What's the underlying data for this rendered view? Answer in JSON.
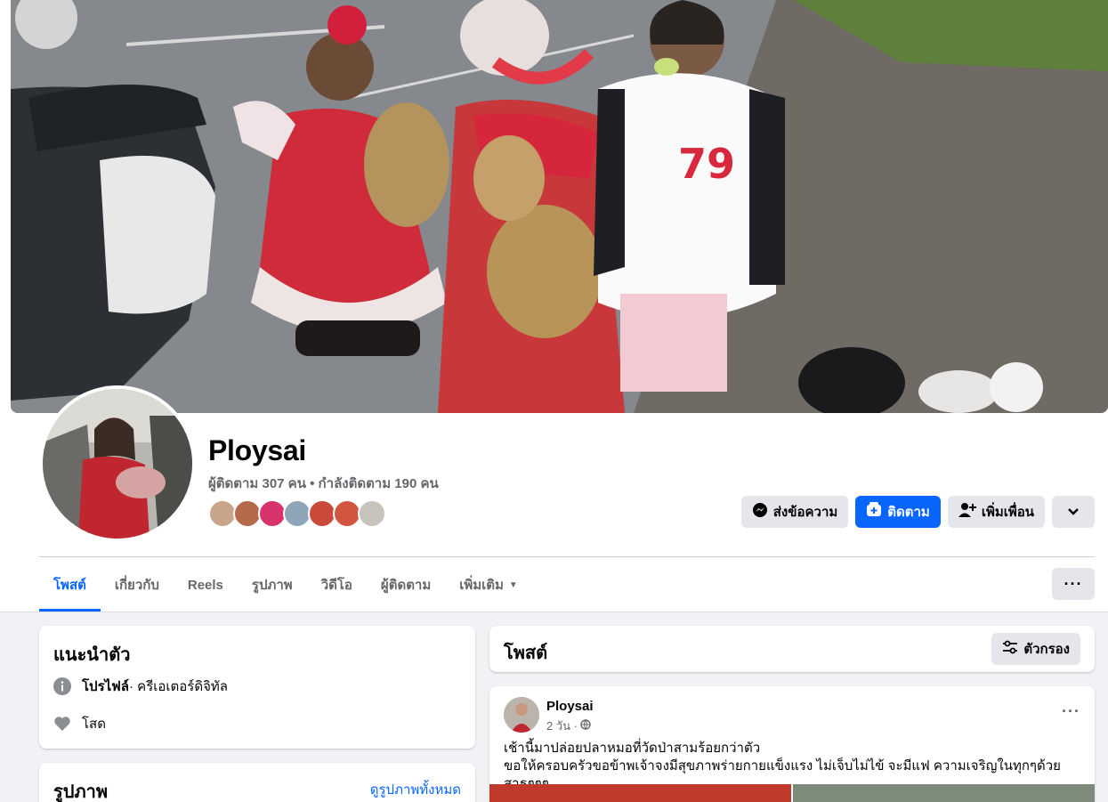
{
  "profile": {
    "name": "Ploysai",
    "stats": "ผู้ติดตาม 307 คน • กำลังติดตาม 190 คน",
    "friend_avatar_colors": [
      "#c8a58a",
      "#b46a4a",
      "#d6336c",
      "#8ea4b8",
      "#c94a3a",
      "#d2553f",
      "#c7c2bc"
    ]
  },
  "actions": {
    "message": "ส่งข้อความ",
    "follow": "ติดตาม",
    "add_friend": "เพิ่มเพื่อน"
  },
  "tabs": [
    {
      "label": "โพสต์"
    },
    {
      "label": "เกี่ยวกับ"
    },
    {
      "label": "Reels"
    },
    {
      "label": "รูปภาพ"
    },
    {
      "label": "วิดีโอ"
    },
    {
      "label": "ผู้ติดตาม"
    },
    {
      "label": "เพิ่มเติม"
    }
  ],
  "intro": {
    "title": "แนะนำตัว",
    "profile_label": "โปรไฟล์",
    "profile_value": " · ครีเอเตอร์ดิจิทัล",
    "relationship": "โสด"
  },
  "photos": {
    "title": "รูปภาพ",
    "see_all": "ดูรูปภาพทั้งหมด"
  },
  "posts": {
    "title": "โพสต์",
    "filter": "ตัวกรอง"
  },
  "post": {
    "author": "Ploysai",
    "time": "2 วัน ·",
    "line1": "เช้านี้มาปล่อยปลาหมอที่วัดป่าสามร้อยกว่าตัว",
    "line2": "ขอให้ครอบครัวขอข้าพเจ้าจงมีสุขภาพร่ายกายแข็งแรง ไม่เจ็บไม่ไข้ จะมีแฟ ความเจริญในทุกๆด้วย สาธุๆๆๆ"
  },
  "colors": {
    "accent": "#0866ff",
    "secondary_text": "#65676b",
    "grey_button": "#e4e6eb",
    "page_background": "#f0f2f5"
  }
}
